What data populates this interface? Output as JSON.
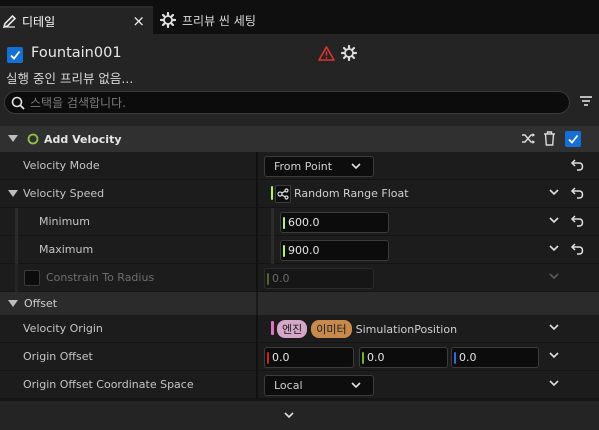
{
  "tabs": [
    {
      "label": "디테일",
      "active": true
    },
    {
      "label": "프리뷰 씬 세팅",
      "active": false
    }
  ],
  "tab_close": "×",
  "emitter": {
    "name": "Fountain001",
    "enabled": true,
    "preview_status": "실행 중인 프리뷰 없음..."
  },
  "search": {
    "placeholder": "스택을 검색합니다."
  },
  "module": {
    "title": "Add Velocity",
    "enabled": true
  },
  "properties": {
    "velocity_mode": {
      "label": "Velocity Mode",
      "value": "From Point"
    },
    "velocity_speed": {
      "label": "Velocity Speed",
      "value": "Random Range Float"
    },
    "minimum": {
      "label": "Minimum",
      "value": "600.0"
    },
    "maximum": {
      "label": "Maximum",
      "value": "900.0"
    },
    "constrain_to_radius": {
      "label": "Constrain To Radius",
      "value": "0.0",
      "checked": false
    }
  },
  "offset_section": {
    "title": "Offset"
  },
  "offset": {
    "velocity_origin": {
      "label": "Velocity Origin",
      "tag1": "엔진",
      "tag2": "이미터",
      "value": "SimulationPosition"
    },
    "origin_offset": {
      "label": "Origin Offset",
      "x": "0.0",
      "y": "0.0",
      "z": "0.0"
    },
    "coordinate_space": {
      "label": "Origin Offset Coordinate Space",
      "value": "Local"
    }
  },
  "colors": {
    "accent": "#1470d6",
    "x_axis": "#c8221b",
    "y_axis": "#6fb52c",
    "z_axis": "#2c6fd6",
    "float_bar": "#b8f26a",
    "engine_tag": "#d4a6c8",
    "emitter_tag": "#c88a4a",
    "warning": "#e0322e"
  }
}
